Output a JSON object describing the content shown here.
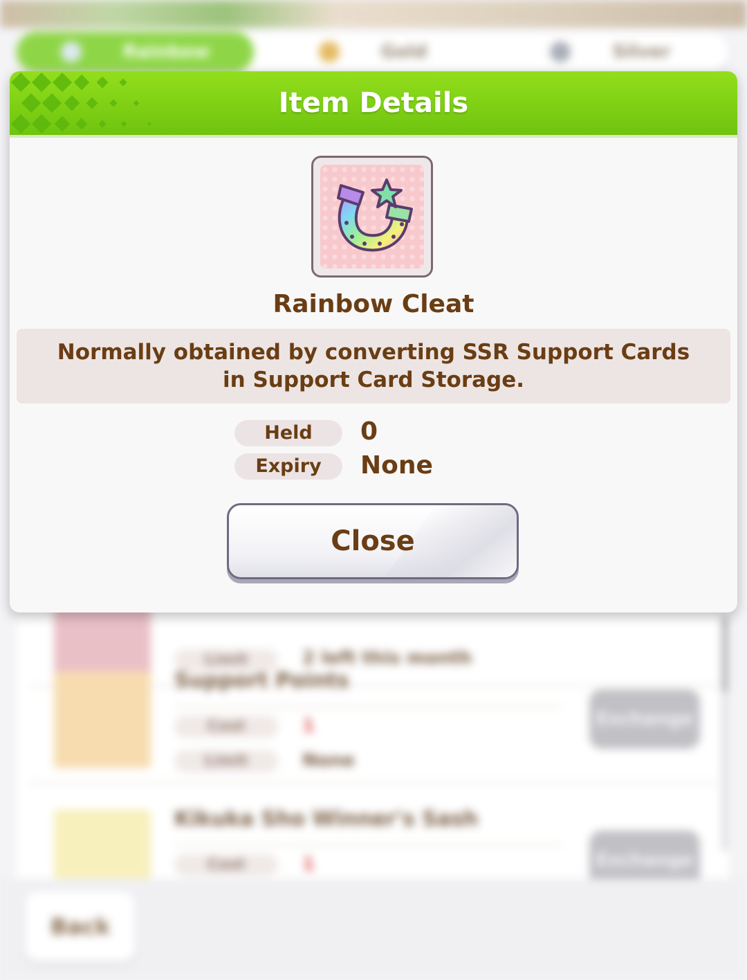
{
  "background": {
    "tabs": [
      {
        "label": "Rainbow",
        "icon": "rainbow-cleat-icon"
      },
      {
        "label": "Gold",
        "icon": "gold-cleat-icon"
      },
      {
        "label": "Silver",
        "icon": "silver-cleat-icon"
      }
    ],
    "list": [
      {
        "title": "",
        "cost_label": "Limit",
        "limit_text": "2 left this month"
      },
      {
        "title": "Support Points",
        "cost_label": "Cost",
        "cost_value": "1",
        "limit_label": "Limit",
        "limit_value": "None",
        "button": "Exchange"
      },
      {
        "title": "Kikuka Sho Winner's Sash",
        "cost_label": "Cost",
        "cost_value": "1",
        "button": "Exchange"
      }
    ],
    "back_label": "Back"
  },
  "modal": {
    "title": "Item Details",
    "item": {
      "name": "Rainbow Cleat",
      "icon": "rainbow-horseshoe-icon",
      "description": "Normally obtained by converting SSR Support Cards in Support Card Storage."
    },
    "stats": [
      {
        "label": "Held",
        "value": "0"
      },
      {
        "label": "Expiry",
        "value": "None"
      }
    ],
    "close_label": "Close"
  },
  "colors": {
    "header_green": "#7fd12e",
    "text_brown": "#6a3d14",
    "pill_bg": "#ece4e4"
  }
}
